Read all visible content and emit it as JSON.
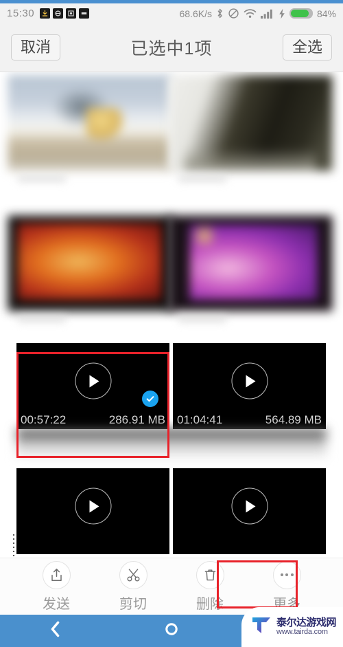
{
  "status_bar": {
    "clock": "15:30",
    "network_speed": "68.6K/s",
    "battery_percent": "84%",
    "left_icons": [
      "download-icon",
      "sync-icon",
      "alarm-icon",
      "silent-icon"
    ],
    "right_icons": [
      "bluetooth-icon",
      "dnd-icon",
      "wifi-icon",
      "signal-icon",
      "charging-icon",
      "battery-icon"
    ]
  },
  "action_bar": {
    "cancel_label": "取消",
    "title": "已选中1项",
    "select_all_label": "全选"
  },
  "photo_grid": [
    {
      "name": "photo-sky",
      "caption_blurred": true
    },
    {
      "name": "photo-dark",
      "caption_blurred": true
    },
    {
      "name": "photo-orange",
      "caption_blurred": true
    },
    {
      "name": "photo-purple",
      "caption_blurred": true
    }
  ],
  "video_items": [
    {
      "duration": "00:57:22",
      "size": "286.91 MB",
      "selected": true
    },
    {
      "duration": "01:04:41",
      "size": "564.89 MB",
      "selected": false
    },
    {
      "duration": "",
      "size": "",
      "selected": false
    },
    {
      "duration": "",
      "size": "",
      "selected": false
    }
  ],
  "toolbar": [
    {
      "icon": "share-upload-icon",
      "label": "发送",
      "highlighted": false
    },
    {
      "icon": "scissors-icon",
      "label": "剪切",
      "highlighted": false
    },
    {
      "icon": "trash-icon",
      "label": "删除",
      "highlighted": false
    },
    {
      "icon": "ellipsis-icon",
      "label": "更多",
      "highlighted": true
    }
  ],
  "nav_bar": {
    "back": "back-chevron-icon",
    "home": "home-circle-icon"
  },
  "watermark": {
    "title": "泰尔达游戏网",
    "url": "www.tairda.com"
  },
  "colors": {
    "accent_blue": "#4a90cd",
    "check_blue": "#1aa3f0",
    "highlight_red": "#e8222a",
    "battery_green": "#3fc24a",
    "bar_bg": "#f2f2f2"
  },
  "annotations": [
    {
      "name": "selected-video-highlight"
    },
    {
      "name": "more-button-highlight"
    }
  ]
}
